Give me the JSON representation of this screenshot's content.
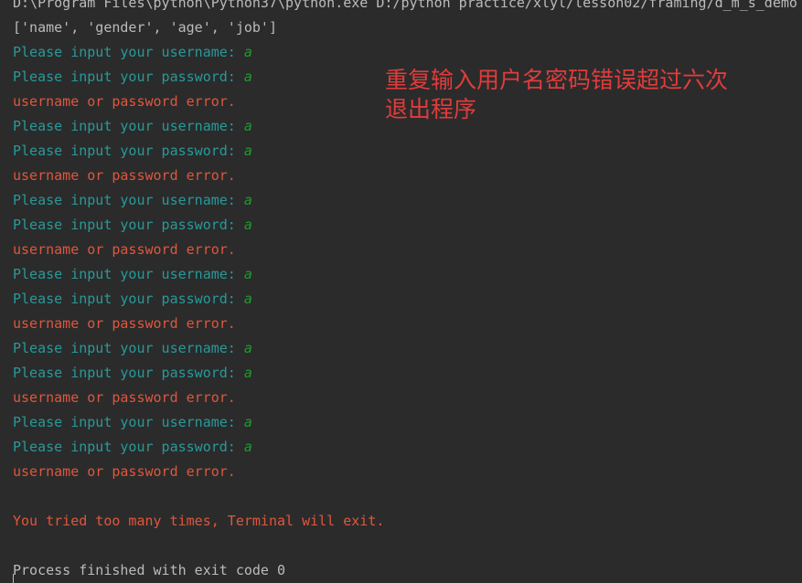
{
  "console": {
    "command_line": "D:\\Program Files\\python\\Python37\\python.exe D:/python practice/xlyl/lesson02/framing/d_m_s_demo",
    "list_output": "['name', 'gender', 'age', 'job']",
    "prompt_username": "Please input your username: ",
    "prompt_password": "Please input your password: ",
    "input_value": "a",
    "error_message": "username or password error.",
    "attempts": [
      {
        "username": "a",
        "password": "a"
      },
      {
        "username": "a",
        "password": "a"
      },
      {
        "username": "a",
        "password": "a"
      },
      {
        "username": "a",
        "password": "a"
      },
      {
        "username": "a",
        "password": "a"
      },
      {
        "username": "a",
        "password": "a"
      }
    ],
    "exit_message": "You tried too many times, Terminal will exit.",
    "process_finished": "Process finished with exit code 0"
  },
  "annotation": {
    "line1": "重复输入用户名密码错误超过六次",
    "line2": "退出程序"
  },
  "colors": {
    "background": "#2b2b2b",
    "plain_text": "#bbbbbb",
    "prompt": "#299999",
    "user_input": "#1f9b2f",
    "error": "#e0563c",
    "annotation": "#e03c3c"
  }
}
